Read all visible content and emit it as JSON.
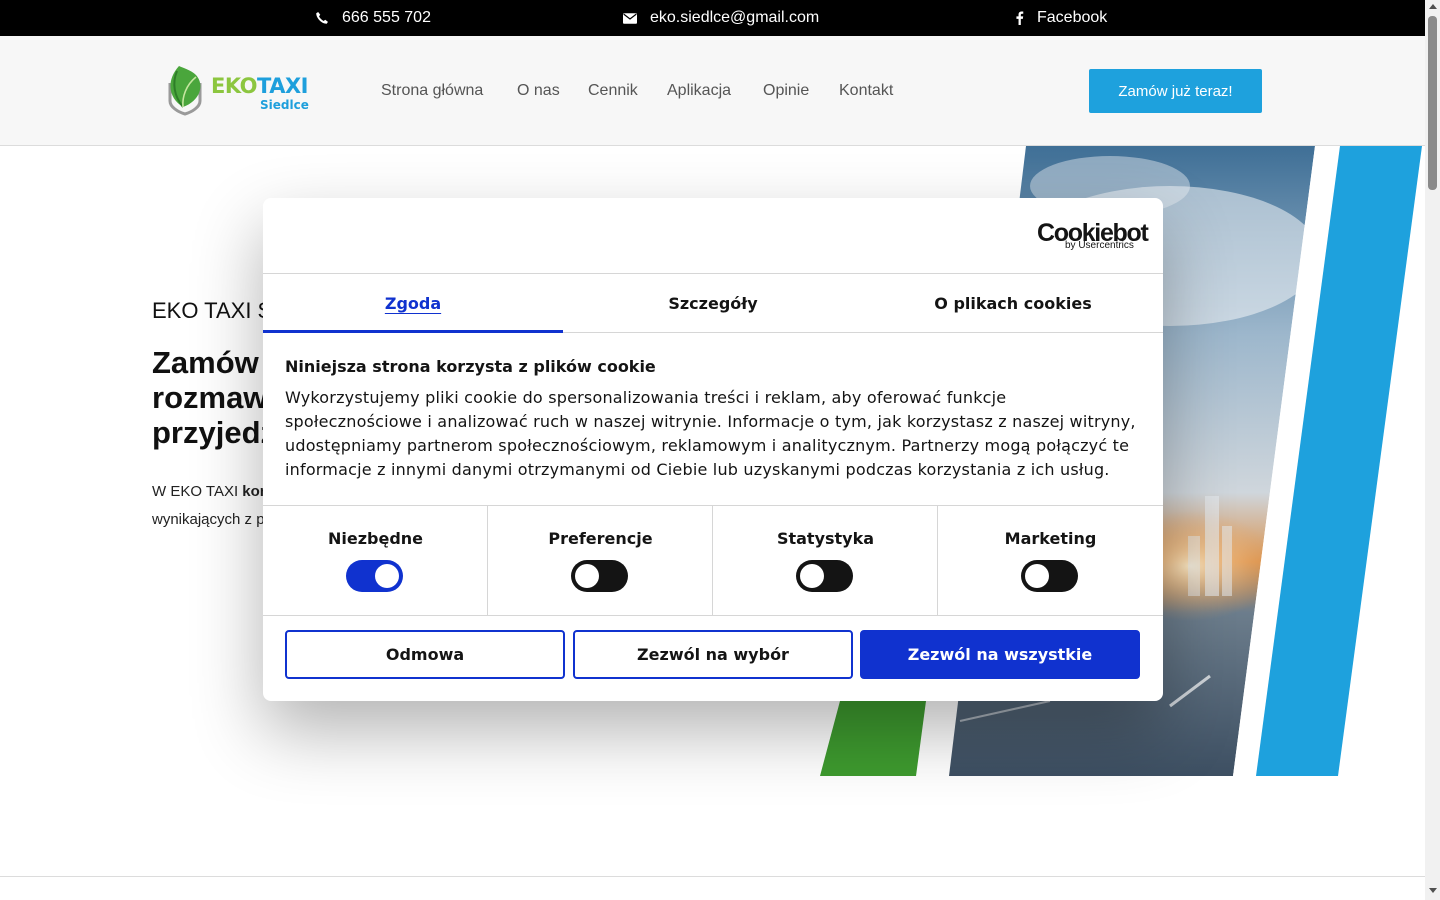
{
  "topbar": {
    "phone": "666 555 702",
    "email": "eko.siedlce@gmail.com",
    "facebook": "Facebook"
  },
  "header": {
    "logo_eko": "EKO",
    "logo_taxi": "TAXI",
    "logo_sub": "Siedlce",
    "nav": [
      "Strona główna",
      "O nas",
      "Cennik",
      "Aplikacja",
      "Opinie",
      "Kontakt"
    ],
    "cta": "Zamów już teraz!"
  },
  "hero": {
    "subtitle": "EKO TAXI S",
    "title_lines": [
      "Zamów",
      "rozmaw",
      "przyjedz"
    ],
    "desc_line1_prefix": "W EKO TAXI ",
    "desc_line1_bold": "kon",
    "desc_line2": "wynikających z p"
  },
  "cookie_dialog": {
    "brand": "Cookiebot",
    "brand_sub": "by Usercentrics",
    "tabs": [
      "Zgoda",
      "Szczegóły",
      "O plikach cookies"
    ],
    "title": "Niniejsza strona korzysta z plików cookie",
    "body": "Wykorzystujemy pliki cookie do spersonalizowania treści i reklam, aby oferować funkcje społecznościowe i analizować ruch w naszej witrynie. Informacje o tym, jak korzystasz z naszej witryny, udostępniamy partnerom społecznościowym, reklamowym i analitycznym. Partnerzy mogą połączyć te informacje z innymi danymi otrzymanymi od Ciebie lub uzyskanymi podczas korzystania z ich usług.",
    "categories": [
      {
        "label": "Niezbędne",
        "enabled": true
      },
      {
        "label": "Preferencje",
        "enabled": false
      },
      {
        "label": "Statystyka",
        "enabled": false
      },
      {
        "label": "Marketing",
        "enabled": false
      }
    ],
    "buttons": {
      "deny": "Odmowa",
      "allow_selection": "Zezwól na wybór",
      "allow_all": "Zezwól na wszystkie"
    }
  },
  "colors": {
    "accent_blue": "#1ea1dd",
    "cookie_blue": "#1032cf",
    "leaf_green": "#8cc63f",
    "stripe_green": "#3e9b2f"
  }
}
